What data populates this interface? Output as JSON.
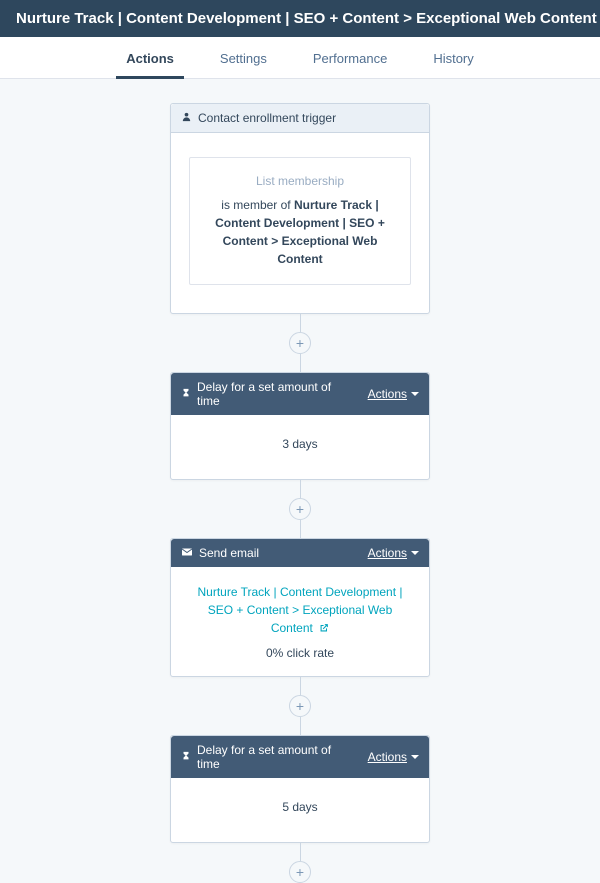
{
  "header": {
    "title": "Nurture Track | Content Development | SEO + Content > Exceptional Web Content"
  },
  "tabs": {
    "items": [
      {
        "label": "Actions",
        "active": true
      },
      {
        "label": "Settings",
        "active": false
      },
      {
        "label": "Performance",
        "active": false
      },
      {
        "label": "History",
        "active": false
      }
    ]
  },
  "trigger": {
    "head_label": "Contact enrollment trigger",
    "sub_label": "List membership",
    "prefix": "is member of ",
    "bold": "Nurture Track | Content Development | SEO + Content > Exceptional Web Content"
  },
  "delay1": {
    "head_label": "Delay for a set amount of time",
    "actions_label": "Actions",
    "body_text": "3 days"
  },
  "email": {
    "head_label": "Send email",
    "actions_label": "Actions",
    "link_text": "Nurture Track | Content Development | SEO + Content > Exceptional Web Content",
    "click_rate": "0% click rate"
  },
  "delay2": {
    "head_label": "Delay for a set amount of time",
    "actions_label": "Actions",
    "body_text": "5 days"
  },
  "icons": {
    "plus": "+"
  }
}
